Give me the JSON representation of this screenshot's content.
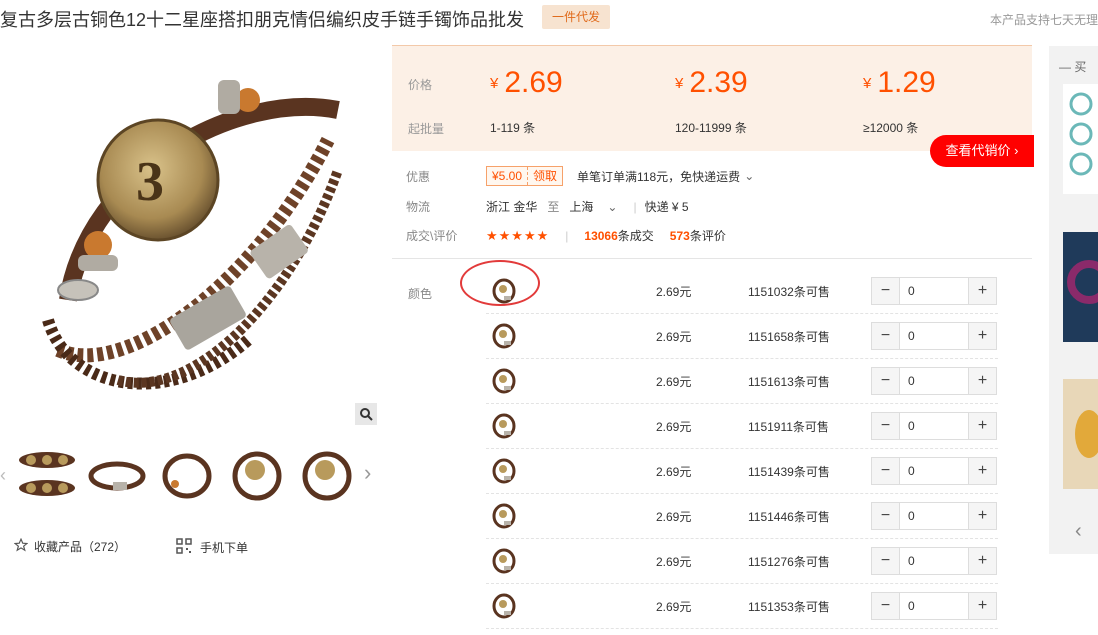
{
  "title": "复古多层古铜色12十二星座搭扣朋克情侣编织皮手链手镯饰品批发",
  "tag": "一件代发",
  "right_note": "本产品支持七天无理",
  "price": {
    "price_label": "价格",
    "moq_label": "起批量",
    "tiers": [
      {
        "price": "2.69",
        "range": "1-119 条"
      },
      {
        "price": "2.39",
        "range": "120-11999 条"
      },
      {
        "price": "1.29",
        "range": "≥12000 条"
      }
    ],
    "yen": "¥",
    "agent_btn": "查看代销价 ›"
  },
  "promo": {
    "label": "优惠",
    "coupon_value": "¥5.00",
    "coupon_action": "领取",
    "text": "单笔订单满118元，免快递运费"
  },
  "logistics": {
    "label": "物流",
    "from": "浙江 金华",
    "to_word": "至",
    "to": "上海",
    "sep": "|",
    "method": "快递 ¥ 5"
  },
  "rating": {
    "label": "成交\\评价",
    "stars": "★★★★★",
    "deals_num": "13066",
    "deals_suffix": "条成交",
    "reviews_num": "573",
    "reviews_suffix": "条评价"
  },
  "color_label": "颜色",
  "sku_rows": [
    {
      "price": "2.69元",
      "stock": "1151032条可售",
      "qty": "0"
    },
    {
      "price": "2.69元",
      "stock": "1151658条可售",
      "qty": "0"
    },
    {
      "price": "2.69元",
      "stock": "1151613条可售",
      "qty": "0"
    },
    {
      "price": "2.69元",
      "stock": "1151911条可售",
      "qty": "0"
    },
    {
      "price": "2.69元",
      "stock": "1151439条可售",
      "qty": "0"
    },
    {
      "price": "2.69元",
      "stock": "1151446条可售",
      "qty": "0"
    },
    {
      "price": "2.69元",
      "stock": "1151276条可售",
      "qty": "0"
    },
    {
      "price": "2.69元",
      "stock": "1151353条可售",
      "qty": "0"
    }
  ],
  "stepper": {
    "minus": "−",
    "plus": "+"
  },
  "favorites": {
    "icon": "star-outline-icon",
    "text": "收藏产品（272）"
  },
  "mobile_order": {
    "icon": "qr-code-icon",
    "text": "手机下单"
  },
  "side": {
    "head": "买"
  },
  "colors": {
    "accent": "#ff5000",
    "agent_btn": "#ff0000",
    "price_bg": "#fcf0e6"
  }
}
